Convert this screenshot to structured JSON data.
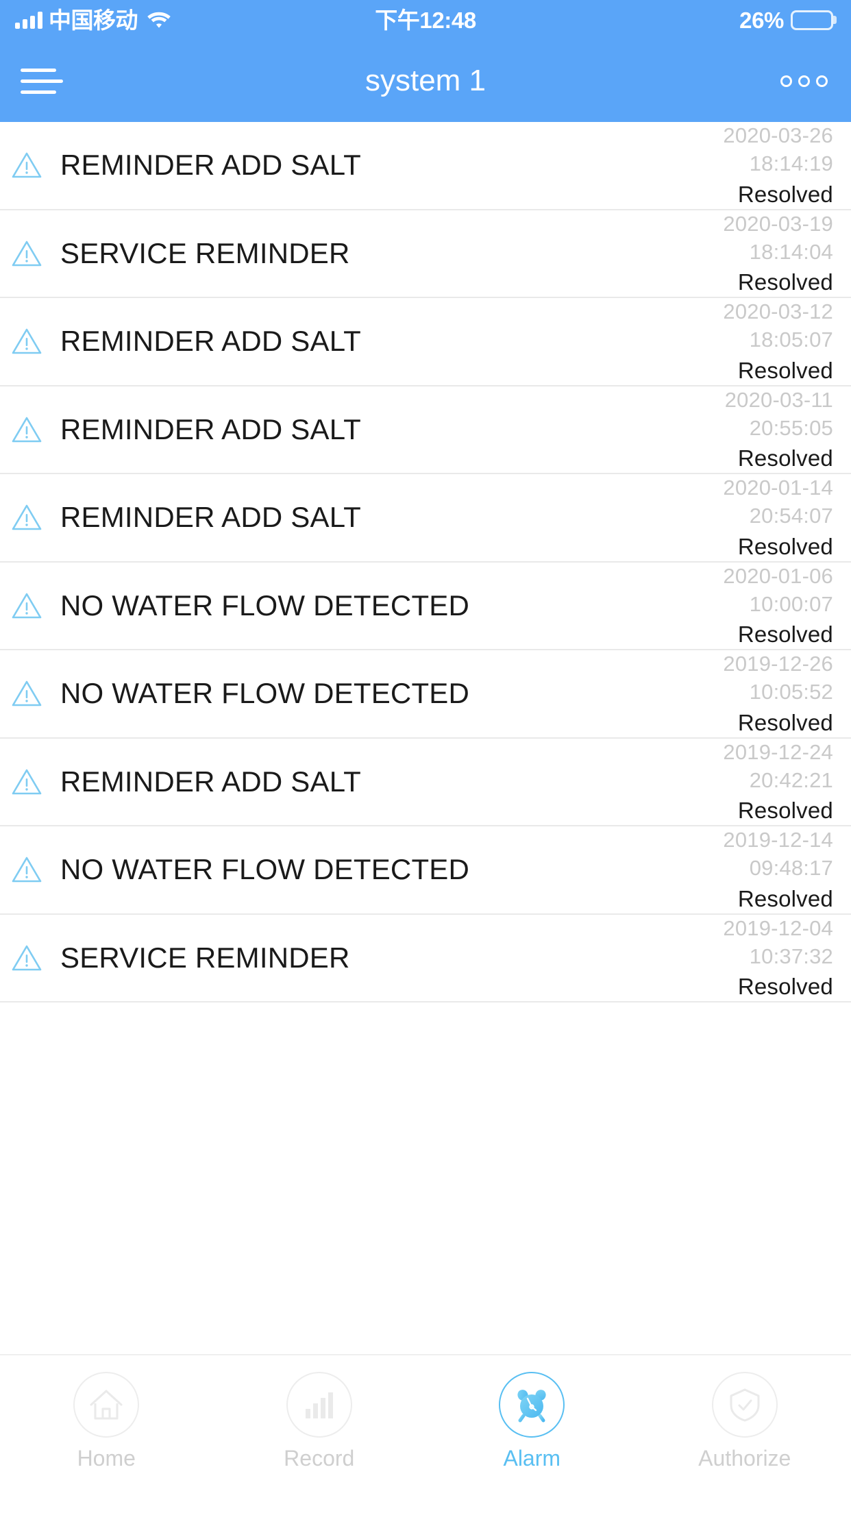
{
  "status_bar": {
    "carrier": "中国移动",
    "signal_icon": "signal-bars-icon",
    "wifi_icon": "wifi-icon",
    "time": "下午12:48",
    "battery_percent": "26%",
    "battery_level": 26,
    "battery_color": "#FFD84D",
    "battery_icon": "battery-icon"
  },
  "header": {
    "title": "system 1",
    "menu_icon": "hamburger-menu-icon",
    "more_icon": "more-options-icon",
    "background_color": "#5AA5F8"
  },
  "alarms": [
    {
      "icon": "warning-triangle-icon",
      "title": "REMINDER ADD SALT",
      "date": "2020-03-26",
      "time": "18:14:19",
      "status": "Resolved"
    },
    {
      "icon": "warning-triangle-icon",
      "title": "SERVICE REMINDER",
      "date": "2020-03-19",
      "time": "18:14:04",
      "status": "Resolved"
    },
    {
      "icon": "warning-triangle-icon",
      "title": "REMINDER ADD SALT",
      "date": "2020-03-12",
      "time": "18:05:07",
      "status": "Resolved"
    },
    {
      "icon": "warning-triangle-icon",
      "title": "REMINDER ADD SALT",
      "date": "2020-03-11",
      "time": "20:55:05",
      "status": "Resolved"
    },
    {
      "icon": "warning-triangle-icon",
      "title": "REMINDER ADD SALT",
      "date": "2020-01-14",
      "time": "20:54:07",
      "status": "Resolved"
    },
    {
      "icon": "warning-triangle-icon",
      "title": "NO WATER FLOW DETECTED",
      "date": "2020-01-06",
      "time": "10:00:07",
      "status": "Resolved"
    },
    {
      "icon": "warning-triangle-icon",
      "title": "NO WATER FLOW DETECTED",
      "date": "2019-12-26",
      "time": "10:05:52",
      "status": "Resolved"
    },
    {
      "icon": "warning-triangle-icon",
      "title": "REMINDER ADD SALT",
      "date": "2019-12-24",
      "time": "20:42:21",
      "status": "Resolved"
    },
    {
      "icon": "warning-triangle-icon",
      "title": "NO WATER FLOW DETECTED",
      "date": "2019-12-14",
      "time": "09:48:17",
      "status": "Resolved"
    },
    {
      "icon": "warning-triangle-icon",
      "title": "SERVICE REMINDER",
      "date": "2019-12-04",
      "time": "10:37:32",
      "status": "Resolved"
    }
  ],
  "tab_bar": {
    "active_color": "#59BFF2",
    "inactive_color": "#CFCFCF",
    "items": [
      {
        "label": "Home",
        "icon": "home-icon",
        "active": false
      },
      {
        "label": "Record",
        "icon": "bar-chart-icon",
        "active": false
      },
      {
        "label": "Alarm",
        "icon": "alarm-clock-icon",
        "active": true
      },
      {
        "label": "Authorize",
        "icon": "shield-check-icon",
        "active": false
      }
    ]
  }
}
